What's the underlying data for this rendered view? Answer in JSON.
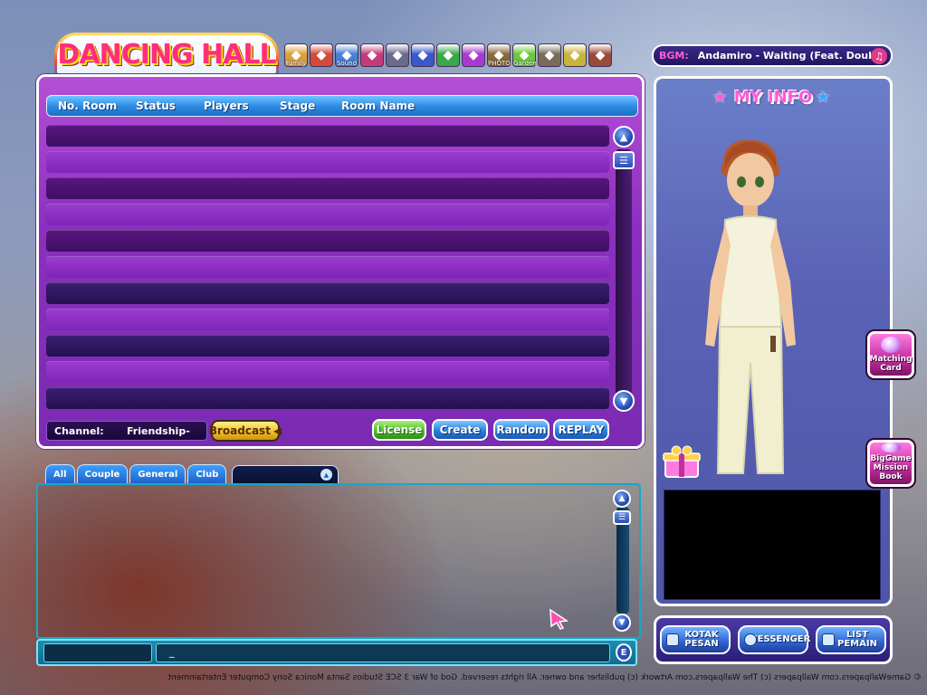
{
  "logo": {
    "text": "DANCING HALL"
  },
  "toolbar": {
    "buttons": [
      {
        "name": "family",
        "label": "Family",
        "color": "#d9a23a"
      },
      {
        "name": "gift",
        "label": "",
        "color": "#d24a3a"
      },
      {
        "name": "sound",
        "label": "Sound",
        "color": "#4a7fd6"
      },
      {
        "name": "box",
        "label": "",
        "color": "#c43a7a"
      },
      {
        "name": "lock",
        "label": "",
        "color": "#6a6a8a"
      },
      {
        "name": "face",
        "label": "",
        "color": "#3a58c8"
      },
      {
        "name": "puzzle",
        "label": "",
        "color": "#3aa84a"
      },
      {
        "name": "tv",
        "label": "",
        "color": "#a83ad0"
      },
      {
        "name": "photo",
        "label": "PHOTO",
        "color": "#8a6a3a"
      },
      {
        "name": "garden",
        "label": "Garden",
        "color": "#6ac83a"
      },
      {
        "name": "bag",
        "label": "",
        "color": "#7a6a5a"
      },
      {
        "name": "note",
        "label": "",
        "color": "#c8b43a"
      },
      {
        "name": "extra",
        "label": "",
        "color": "#9a4a3a"
      }
    ]
  },
  "bgm": {
    "label": "BGM:",
    "value": "Andamiro - Waiting (Feat. Double"
  },
  "room_panel": {
    "headers": [
      "No. Room",
      "Status",
      "Players",
      "Stage",
      "Room Name"
    ],
    "row_count": 11,
    "channel_label": "Channel:",
    "channel_value": "Friendship-",
    "broadcast_label": "Broadcast",
    "buttons": {
      "license": "License",
      "create": "Create",
      "random": "Random",
      "replay": "REPLAY"
    }
  },
  "chat": {
    "tabs": [
      "All",
      "Couple",
      "General",
      "Club"
    ],
    "input_value": "_"
  },
  "info": {
    "title": "MY INFO",
    "matching_card": "Matching Card",
    "biggame": "BigGame Mission Book"
  },
  "bottom_buttons": {
    "kotak_pesan": "KOTAK PESAN",
    "messenger": "MESSENGER",
    "list_pemain": "LIST PEMAIN"
  },
  "watermark": "© GameWallpapers.com   Wallpapers (c) The Wallpapers.com Artwork (c) publisher and owner. All rights reserved.   God of War 3  SCE Studios Santa Monica  Sony Computer Entertainment"
}
